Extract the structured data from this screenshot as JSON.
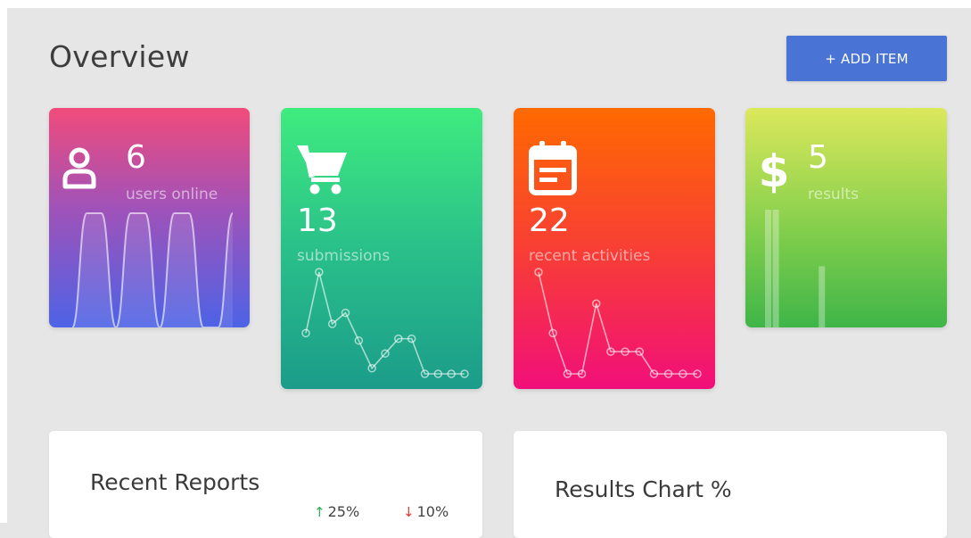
{
  "header": {
    "title": "Overview",
    "add_button_label": "+ ADD ITEM"
  },
  "stat_cards": [
    {
      "value": "6",
      "label": "users online",
      "icon": "user-icon",
      "sparkline_type": "area",
      "sparkline_values": [
        0,
        100,
        100,
        0,
        100,
        100,
        0,
        100,
        100,
        0,
        0,
        100
      ]
    },
    {
      "value": "13",
      "label": "submissions",
      "icon": "cart-icon",
      "sparkline_type": "line",
      "sparkline_values": [
        22,
        55,
        27,
        33,
        18,
        3,
        11,
        19,
        19,
        0,
        0,
        0,
        0
      ]
    },
    {
      "value": "22",
      "label": "recent activities",
      "icon": "calendar-icon",
      "sparkline_type": "line",
      "sparkline_values": [
        55,
        22,
        0,
        0,
        38,
        12,
        12,
        12,
        0,
        0,
        0,
        0
      ]
    },
    {
      "value": "5",
      "label": "results",
      "icon": "dollar-icon",
      "sparkline_type": "bar",
      "sparkline_values": [
        100,
        100,
        0,
        0,
        0,
        0,
        0,
        52
      ]
    }
  ],
  "panels": {
    "reports_title": "Recent Reports",
    "reports_up": "25%",
    "reports_down": "10%",
    "results_title": "Results Chart %"
  },
  "colors": {
    "accent": "#4a73d6",
    "trend_up": "#2bb05a",
    "trend_down": "#e53935"
  }
}
